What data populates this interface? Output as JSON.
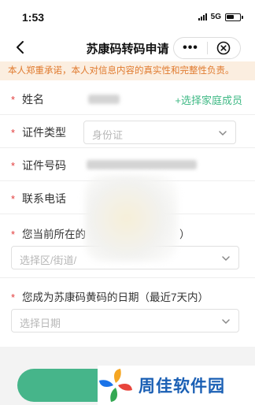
{
  "status_bar": {
    "time": "1:53",
    "network": "5G"
  },
  "nav": {
    "title": "苏康码转码申请"
  },
  "notice": "本人郑重承诺，本人对信息内容的真实性和完整性负责。",
  "form": {
    "name_label": "姓名",
    "add_family_label": "+选择家庭成员",
    "id_type_label": "证件类型",
    "id_type_value": "身份证",
    "id_number_label": "证件号码",
    "phone_label": "联系电话",
    "location_question_prefix": "您当前所在的",
    "location_question_suffix": "）",
    "location_placeholder": "选择区/街道/",
    "date_question": "您成为苏康码黄码的日期（最近7天内）",
    "date_placeholder": "选择日期"
  },
  "watermark": {
    "text": "周佳软件园"
  }
}
